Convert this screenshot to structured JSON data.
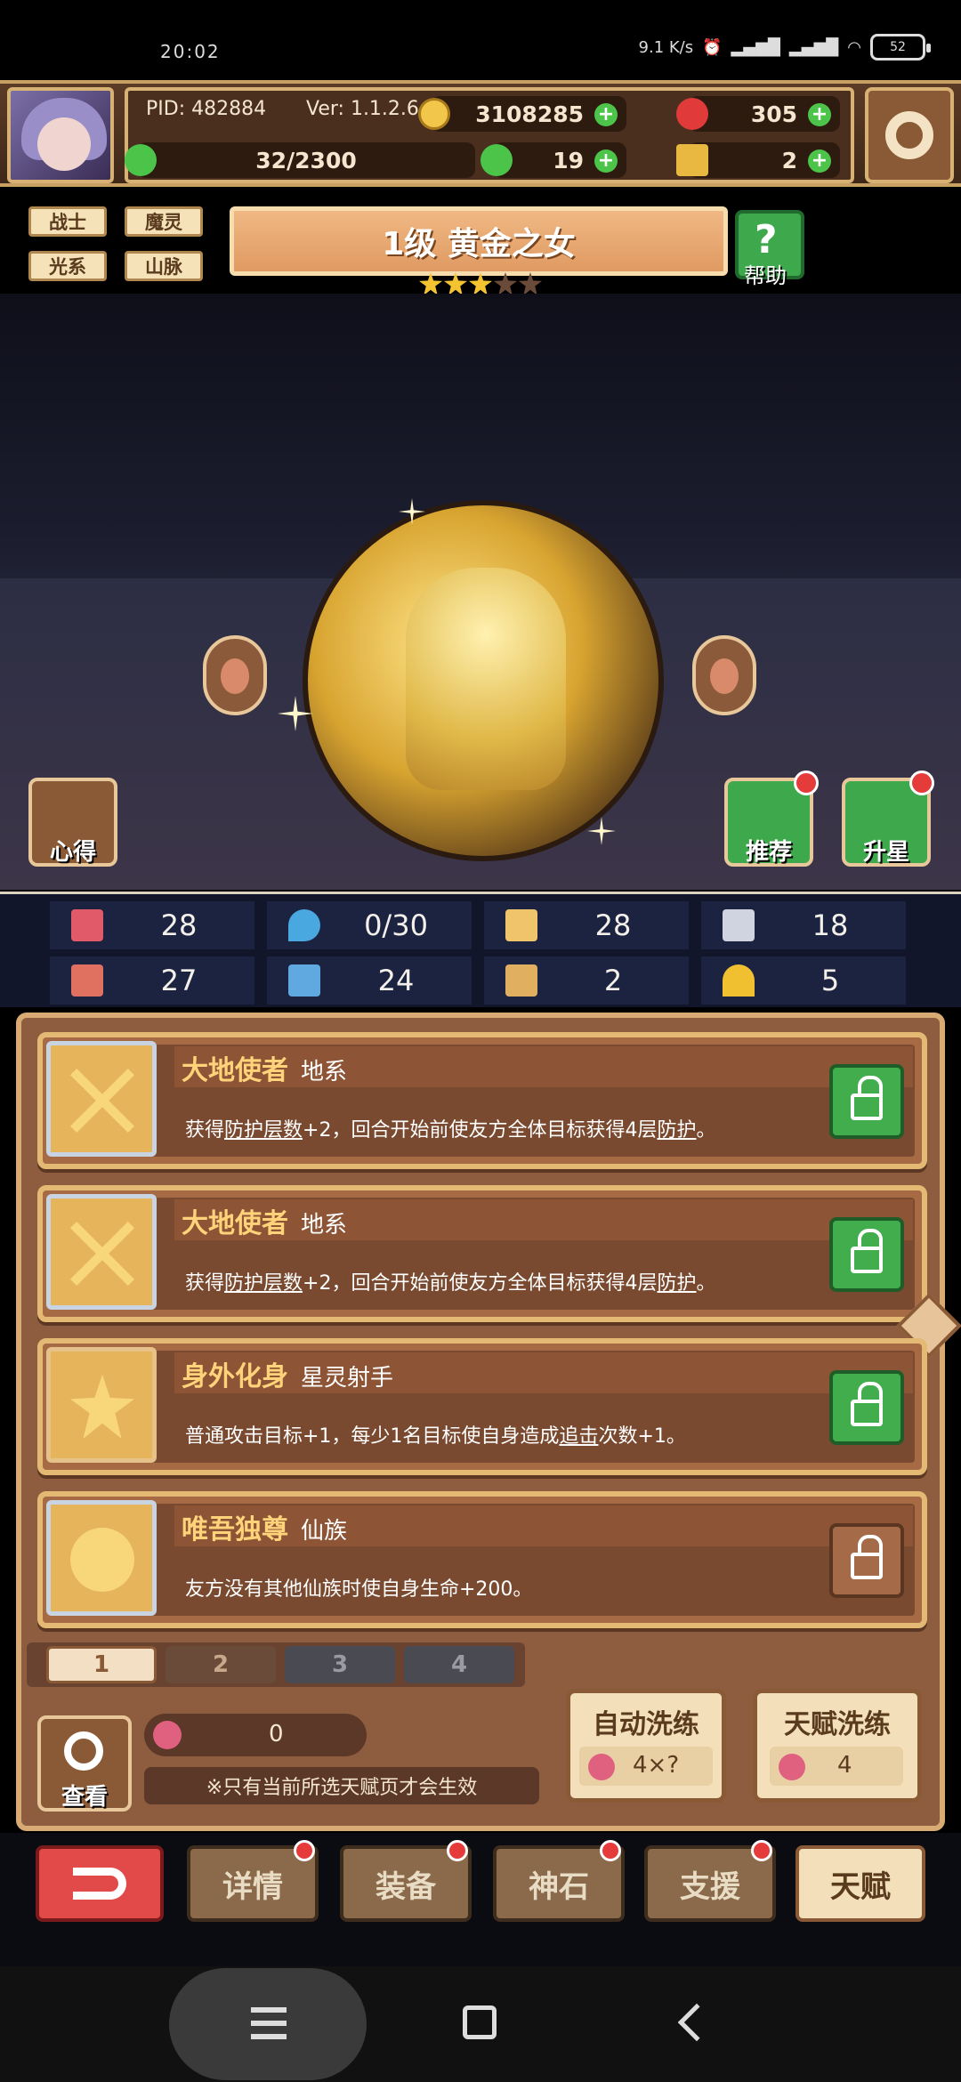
{
  "status_bar": {
    "time": "20:02",
    "net_speed": "9.1 K/s",
    "battery": "52"
  },
  "header": {
    "pid": "PID: 482884",
    "version": "Ver: 1.1.2.6",
    "gold": "3108285",
    "gems": "305",
    "energy": "32/2300",
    "clover": "19",
    "keys": "2"
  },
  "tags": [
    "战士",
    "魔灵",
    "光系",
    "山脉"
  ],
  "title": {
    "text": "1级  黄金之女",
    "stars_total": 5,
    "stars_filled": 3
  },
  "help_label": "帮助",
  "scene_buttons": {
    "notes": "心得",
    "recommend": "推荐",
    "star_up": "升星"
  },
  "stats": [
    {
      "icon": "heart-icon",
      "value": "28",
      "color": "#e05a6a"
    },
    {
      "icon": "drop-icon",
      "value": "0/30",
      "color": "#4aa8e0"
    },
    {
      "icon": "shield-icon",
      "value": "28",
      "color": "#f0c46a"
    },
    {
      "icon": "wing-icon",
      "value": "18",
      "color": "#d0d4e0"
    },
    {
      "icon": "fist-icon",
      "value": "27",
      "color": "#e07060"
    },
    {
      "icon": "book-icon",
      "value": "24",
      "color": "#60a8e0"
    },
    {
      "icon": "card-icon",
      "value": "2",
      "color": "#e0b060"
    },
    {
      "icon": "horseshoe-icon",
      "value": "5",
      "color": "#f0c030"
    }
  ],
  "talents": [
    {
      "name": "大地使者",
      "type": "地系",
      "desc_pre": "获得",
      "desc_u1": "防护层数",
      "desc_mid": "+2，回合开始前使友方全体目标获得4层",
      "desc_u2": "防护",
      "desc_post": "。",
      "locked": true
    },
    {
      "name": "大地使者",
      "type": "地系",
      "desc_pre": "获得",
      "desc_u1": "防护层数",
      "desc_mid": "+2，回合开始前使友方全体目标获得4层",
      "desc_u2": "防护",
      "desc_post": "。",
      "locked": true
    },
    {
      "name": "身外化身",
      "type": "星灵射手",
      "desc_pre": "普通攻击目标+1，每少1名目标使自身造成",
      "desc_u1": "追击",
      "desc_mid": "次数+1。",
      "desc_u2": "",
      "desc_post": "",
      "locked": true
    },
    {
      "name": "唯吾独尊",
      "type": "仙族",
      "desc_pre": "友方没有其他仙族时使自身生命+200。",
      "desc_u1": "",
      "desc_mid": "",
      "desc_u2": "",
      "desc_post": "",
      "locked": false
    }
  ],
  "pages": [
    "1",
    "2",
    "3",
    "4"
  ],
  "controls": {
    "view_label": "查看",
    "potion_count": "0",
    "hint": "※只有当前所选天赋页才会生效",
    "auto_refine_label": "自动洗练",
    "auto_refine_cost": "4×?",
    "talent_refine_label": "天赋洗练",
    "talent_refine_cost": "4"
  },
  "bottom_nav": {
    "details": "详情",
    "equip": "装备",
    "stone": "神石",
    "support": "支援",
    "talent": "天赋"
  }
}
